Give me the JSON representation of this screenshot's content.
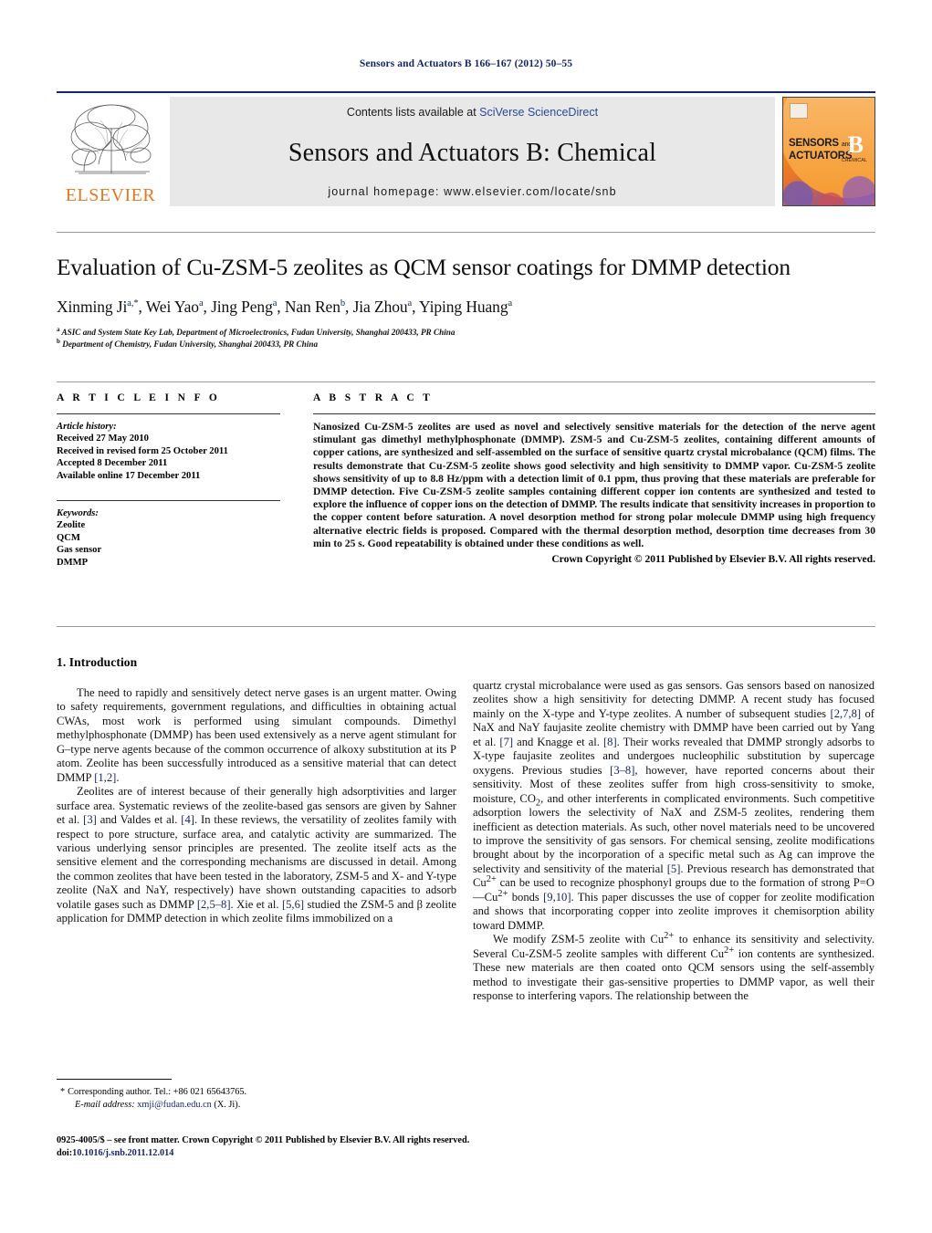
{
  "running_head": "Sensors and Actuators B 166–167 (2012) 50–55",
  "masthead": {
    "publisher_name": "ELSEVIER",
    "contents_prefix": "Contents lists available at ",
    "contents_link": "SciVerse ScienceDirect",
    "journal_title": "Sensors and Actuators B: Chemical",
    "homepage_label": "journal homepage:",
    "homepage_url": "www.elsevier.com/locate/snb",
    "cover": {
      "line1": "SENSORS",
      "and": "and",
      "line2": "ACTUATORS",
      "letter": "B",
      "sublabel": "CHEMICAL"
    }
  },
  "article": {
    "title": "Evaluation of Cu-ZSM-5 zeolites as QCM sensor coatings for DMMP detection",
    "authors_html": "Xinming Ji<sup>a,*</sup>, Wei Yao<sup>a</sup>, Jing Peng<sup>a</sup>, Nan Ren<sup>b</sup>, Jia Zhou<sup>a</sup>, Yiping Huang<sup>a</sup>",
    "affiliation_a": "ASIC and System State Key Lab, Department of Microelectronics, Fudan University, Shanghai 200433, PR China",
    "affiliation_b": "Department of Chemistry, Fudan University, Shanghai 200433, PR China"
  },
  "info": {
    "heading": "A R T I C L E   I N F O",
    "history_label": "Article history:",
    "history": [
      "Received 27 May 2010",
      "Received in revised form 25 October 2011",
      "Accepted 8 December 2011",
      "Available online 17 December 2011"
    ],
    "keywords_label": "Keywords:",
    "keywords": [
      "Zeolite",
      "QCM",
      "Gas sensor",
      "DMMP"
    ]
  },
  "abstract": {
    "heading": "A B S T R A C T",
    "text": "Nanosized Cu-ZSM-5 zeolites are used as novel and selectively sensitive materials for the detection of the nerve agent stimulant gas dimethyl methylphosphonate (DMMP). ZSM-5 and Cu-ZSM-5 zeolites, containing different amounts of copper cations, are synthesized and self-assembled on the surface of sensitive quartz crystal microbalance (QCM) films. The results demonstrate that Cu-ZSM-5 zeolite shows good selectivity and high sensitivity to DMMP vapor. Cu-ZSM-5 zeolite shows sensitivity of up to 8.8 Hz/ppm with a detection limit of 0.1 ppm, thus proving that these materials are preferable for DMMP detection. Five Cu-ZSM-5 zeolite samples containing different copper ion contents are synthesized and tested to explore the influence of copper ions on the detection of DMMP. The results indicate that sensitivity increases in proportion to the copper content before saturation. A novel desorption method for strong polar molecule DMMP using high frequency alternative electric fields is proposed. Compared with the thermal desorption method, desorption time decreases from 30 min to 25 s. Good repeatability is obtained under these conditions as well.",
    "copyright": "Crown Copyright © 2011 Published by Elsevier B.V. All rights reserved."
  },
  "body": {
    "section_number_title": "1.  Introduction",
    "left_paragraphs": [
      "The need to rapidly and sensitively detect nerve gases is an urgent matter. Owing to safety requirements, government regulations, and difficulties in obtaining actual CWAs, most work is performed using simulant compounds. Dimethyl methylphosphonate (DMMP) has been used extensively as a nerve agent stimulant for G–type nerve agents because of the common occurrence of alkoxy substitution at its P atom. Zeolite has been successfully introduced as a sensitive material that can detect DMMP [1,2].",
      "Zeolites are of interest because of their generally high adsorptivities and larger surface area. Systematic reviews of the zeolite-based gas sensors are given by Sahner et al. [3] and Valdes et al. [4]. In these reviews, the versatility of zeolites family with respect to pore structure, surface area, and catalytic activity are summarized. The various underlying sensor principles are presented. The zeolite itself acts as the sensitive element and the corresponding mechanisms are discussed in detail. Among the common zeolites that have been tested in the laboratory, ZSM-5 and X- and Y-type zeolite (NaX and NaY, respectively) have shown outstanding capacities to adsorb volatile gases such as DMMP [2,5–8]. Xie et al. [5,6] studied the ZSM-5 and β zeolite application for DMMP detection in which zeolite films immobilized on a"
    ],
    "right_paragraphs": [
      "quartz crystal microbalance were used as gas sensors. Gas sensors based on nanosized zeolites show a high sensitivity for detecting DMMP. A recent study has focused mainly on the X-type and Y-type zeolites. A number of subsequent studies [2,7,8] of NaX and NaY faujasite zeolite chemistry with DMMP have been carried out by Yang et al. [7] and Knagge et al. [8]. Their works revealed that DMMP strongly adsorbs to X-type faujasite zeolites and undergoes nucleophilic substitution by supercage oxygens. Previous studies [3–8], however, have reported concerns about their sensitivity. Most of these zeolites suffer from high cross-sensitivity to smoke, moisture, CO2, and other interferents in complicated environments. Such competitive adsorption lowers the selectivity of NaX and ZSM-5 zeolites, rendering them inefficient as detection materials. As such, other novel materials need to be uncovered to improve the sensitivity of gas sensors. For chemical sensing, zeolite modifications brought about by the incorporation of a specific metal such as Ag can improve the selectivity and sensitivity of the material [5]. Previous research has demonstrated that Cu2+ can be used to recognize phosphonyl groups due to the formation of strong P=O—Cu2+ bonds [9,10]. This paper discusses the use of copper for zeolite modification and shows that incorporating copper into zeolite improves it chemisorption ability toward DMMP.",
      "We modify ZSM-5 zeolite with Cu2+ to enhance its sensitivity and selectivity. Several Cu-ZSM-5 zeolite samples with different Cu2+ ion contents are synthesized. These new materials are then coated onto QCM sensors using the self-assembly method to investigate their gas-sensitive properties to DMMP vapor, as well their response to interfering vapors. The relationship between the"
    ]
  },
  "footnote": {
    "star": "*",
    "corresponding": "Corresponding author. Tel.: +86 021 65643765.",
    "email_label": "E-mail address:",
    "email": "xmji@fudan.edu.cn",
    "email_suffix": "(X. Ji).",
    "imprint_line": "0925-4005/$ – see front matter. Crown Copyright © 2011 Published by Elsevier B.V. All rights reserved.",
    "doi_label": "doi:",
    "doi": "10.1016/j.snb.2011.12.014"
  },
  "colors": {
    "accent_blue": "#16256b",
    "link_blue": "#2b4a9b",
    "elsevier_orange": "#e87722",
    "band_gray": "#e8e8e8"
  }
}
